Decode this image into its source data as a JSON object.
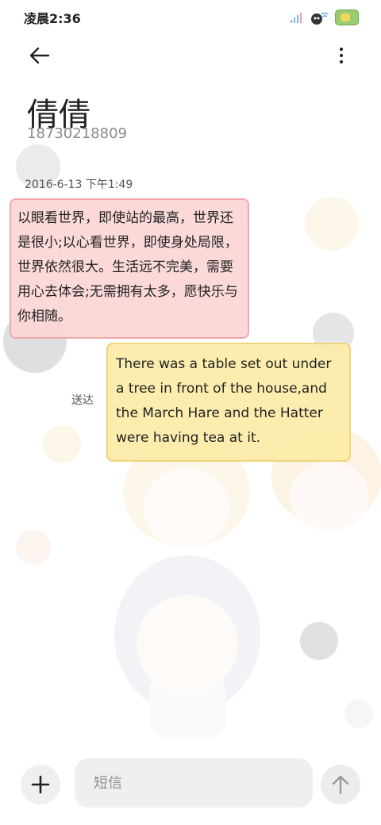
{
  "status_bar": {
    "time": "凌晨2:36"
  },
  "header": {
    "back_icon": "arrow-left-icon",
    "more_icon": "more-vertical-icon"
  },
  "contact": {
    "name": "倩倩",
    "number": "18730218809"
  },
  "conversation": {
    "timestamp": "2016-6-13 下午1:49",
    "messages": [
      {
        "direction": "incoming",
        "text": "以眼看世界，即使站的最高，世界还是很小;以心看世界，即使身处局限，世界依然很大。生活远不完美，需要用心去体会;无需拥有太多，愿快乐与你相随。"
      },
      {
        "direction": "outgoing",
        "text": "There was a table set out under a tree in front of the house,and the March Hare and the Hatter were having tea at it.",
        "status": "送达"
      }
    ]
  },
  "composer": {
    "placeholder": "短信",
    "add_icon": "plus-icon",
    "send_icon": "arrow-up-icon"
  },
  "colors": {
    "incoming_bubble": "#fbd6d6",
    "incoming_border": "#f1a7a8",
    "outgoing_bubble": "#fcecaa",
    "outgoing_border": "#f1d479"
  }
}
